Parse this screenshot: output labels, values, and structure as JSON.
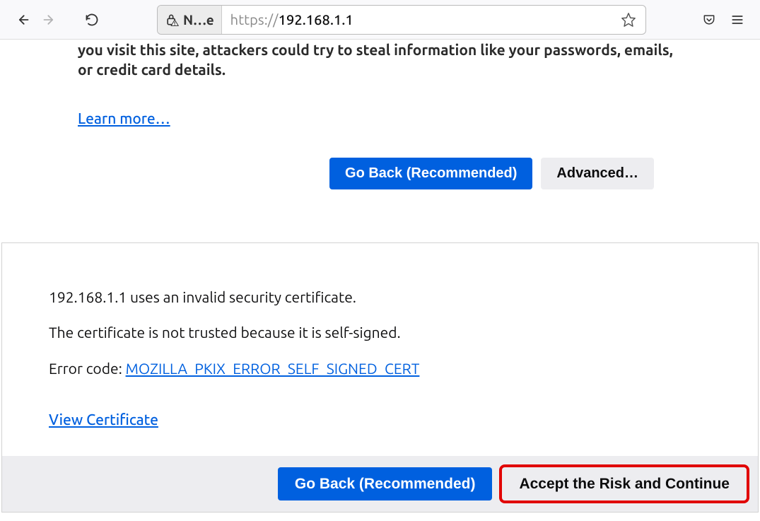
{
  "toolbar": {
    "identity_label": "N…e",
    "url_scheme": "https://",
    "url_host": "192.168.1.1"
  },
  "warning": {
    "truncated_text": "you visit this site, attackers could try to steal information like your passwords, emails, or credit card details.",
    "learn_more": "Learn more…",
    "go_back": "Go Back (Recommended)",
    "advanced": "Advanced…"
  },
  "advanced": {
    "line1": "192.168.1.1 uses an invalid security certificate.",
    "line2": "The certificate is not trusted because it is self-signed.",
    "error_label": "Error code: ",
    "error_code": "MOZILLA_PKIX_ERROR_SELF_SIGNED_CERT",
    "view_cert": "View Certificate",
    "go_back": "Go Back (Recommended)",
    "accept": "Accept the Risk and Continue"
  }
}
